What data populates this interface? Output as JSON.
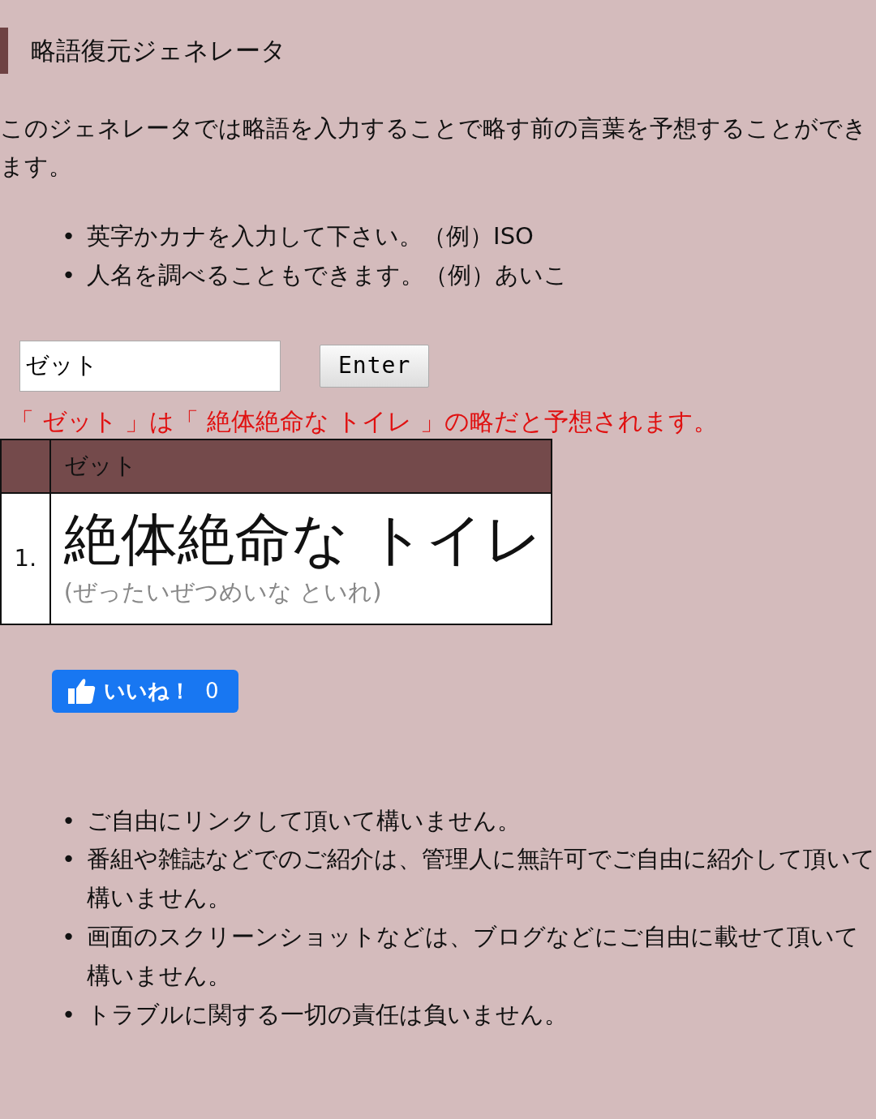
{
  "title": "略語復元ジェネレータ",
  "intro": "このジェネレータでは略語を入力することで略す前の言葉を予想することができます。",
  "hints": [
    {
      "bullet": "•",
      "text": "英字かカナを入力して下さい。（例）ISO"
    },
    {
      "bullet": "•",
      "text": "人名を調べることもできます。（例）あいこ"
    }
  ],
  "search": {
    "value": "ゼット",
    "button": "Enter"
  },
  "result_message": "「 ゼット 」は「 絶体絶命な トイレ 」の略だと予想されます。",
  "table": {
    "columns": [
      "ゼット"
    ],
    "rows": [
      {
        "number": "1.",
        "phrase": "絶体絶命な トイレ",
        "reading": "(ぜったいぜつめいな といれ)"
      }
    ]
  },
  "like": {
    "label": "いいね！",
    "count": "0"
  },
  "notes": [
    {
      "bullet": "•",
      "text": "ご自由にリンクして頂いて構いません。"
    },
    {
      "bullet": "•",
      "text": "番組や雑誌などでのご紹介は、管理人に無許可でご自由に紹介して頂いて構いません。"
    },
    {
      "bullet": "•",
      "text": "画面のスクリーンショットなどは、ブログなどにご自由に載せて頂いて構いません。"
    },
    {
      "bullet": "•",
      "text": "トラブルに関する一切の責任は負いません。"
    }
  ]
}
